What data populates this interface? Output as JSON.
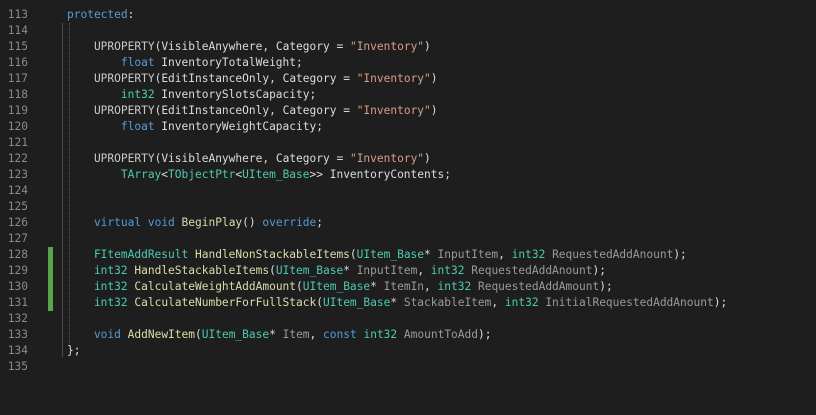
{
  "editor": {
    "lines": [
      {
        "num": "113",
        "tokens": [
          {
            "t": "protected",
            "c": "kw"
          },
          {
            "t": ":",
            "c": "pl"
          }
        ]
      },
      {
        "num": "114",
        "tokens": []
      },
      {
        "num": "115",
        "tokens": [
          {
            "t": "    UPROPERTY",
            "c": "mac"
          },
          {
            "t": "(",
            "c": "pl"
          },
          {
            "t": "VisibleAnywhere",
            "c": "pl"
          },
          {
            "t": ", ",
            "c": "pl"
          },
          {
            "t": "Category",
            "c": "pl"
          },
          {
            "t": " = ",
            "c": "pl"
          },
          {
            "t": "\"Inventory\"",
            "c": "str"
          },
          {
            "t": ")",
            "c": "pl"
          }
        ]
      },
      {
        "num": "116",
        "tokens": [
          {
            "t": "        float",
            "c": "kw"
          },
          {
            "t": " InventoryTotalWeight;",
            "c": "pl"
          }
        ]
      },
      {
        "num": "117",
        "tokens": [
          {
            "t": "    UPROPERTY",
            "c": "mac"
          },
          {
            "t": "(",
            "c": "pl"
          },
          {
            "t": "EditInstanceOnly",
            "c": "pl"
          },
          {
            "t": ", ",
            "c": "pl"
          },
          {
            "t": "Category",
            "c": "pl"
          },
          {
            "t": " = ",
            "c": "pl"
          },
          {
            "t": "\"Inventory\"",
            "c": "str"
          },
          {
            "t": ")",
            "c": "pl"
          }
        ]
      },
      {
        "num": "118",
        "tokens": [
          {
            "t": "        int32",
            "c": "ty"
          },
          {
            "t": " InventorySlotsCapacity;",
            "c": "pl"
          }
        ]
      },
      {
        "num": "119",
        "tokens": [
          {
            "t": "    UPROPERTY",
            "c": "mac"
          },
          {
            "t": "(",
            "c": "pl"
          },
          {
            "t": "EditInstanceOnly",
            "c": "pl"
          },
          {
            "t": ", ",
            "c": "pl"
          },
          {
            "t": "Category",
            "c": "pl"
          },
          {
            "t": " = ",
            "c": "pl"
          },
          {
            "t": "\"Inventory\"",
            "c": "str"
          },
          {
            "t": ")",
            "c": "pl"
          }
        ]
      },
      {
        "num": "120",
        "tokens": [
          {
            "t": "        float",
            "c": "kw"
          },
          {
            "t": " InventoryWeightCapacity;",
            "c": "pl"
          }
        ]
      },
      {
        "num": "121",
        "tokens": []
      },
      {
        "num": "122",
        "tokens": [
          {
            "t": "    UPROPERTY",
            "c": "mac"
          },
          {
            "t": "(",
            "c": "pl"
          },
          {
            "t": "VisibleAnywhere",
            "c": "pl"
          },
          {
            "t": ", ",
            "c": "pl"
          },
          {
            "t": "Category",
            "c": "pl"
          },
          {
            "t": " = ",
            "c": "pl"
          },
          {
            "t": "\"Inventory\"",
            "c": "str"
          },
          {
            "t": ")",
            "c": "pl"
          }
        ]
      },
      {
        "num": "123",
        "tokens": [
          {
            "t": "        TArray",
            "c": "ty"
          },
          {
            "t": "<",
            "c": "pl"
          },
          {
            "t": "TObjectPtr",
            "c": "ty"
          },
          {
            "t": "<",
            "c": "pl"
          },
          {
            "t": "UItem_Base",
            "c": "ty"
          },
          {
            "t": ">> InventoryContents;",
            "c": "pl"
          }
        ]
      },
      {
        "num": "124",
        "tokens": []
      },
      {
        "num": "125",
        "tokens": []
      },
      {
        "num": "126",
        "tokens": [
          {
            "t": "    virtual",
            "c": "kw"
          },
          {
            "t": " ",
            "c": "pl"
          },
          {
            "t": "void",
            "c": "kw"
          },
          {
            "t": " ",
            "c": "pl"
          },
          {
            "t": "BeginPlay",
            "c": "fn"
          },
          {
            "t": "() ",
            "c": "pl"
          },
          {
            "t": "override",
            "c": "kw"
          },
          {
            "t": ";",
            "c": "pl"
          }
        ]
      },
      {
        "num": "127",
        "tokens": []
      },
      {
        "num": "128",
        "tokens": [
          {
            "t": "    FItemAddResult",
            "c": "ty"
          },
          {
            "t": " ",
            "c": "pl"
          },
          {
            "t": "HandleNonStackableItems",
            "c": "fn"
          },
          {
            "t": "(",
            "c": "pl"
          },
          {
            "t": "UItem_Base",
            "c": "ty"
          },
          {
            "t": "* ",
            "c": "pl"
          },
          {
            "t": "InputItem",
            "c": "param"
          },
          {
            "t": ", ",
            "c": "pl"
          },
          {
            "t": "int32",
            "c": "ty"
          },
          {
            "t": " ",
            "c": "pl"
          },
          {
            "t": "RequestedAddAnount",
            "c": "param"
          },
          {
            "t": ");",
            "c": "pl"
          }
        ]
      },
      {
        "num": "129",
        "tokens": [
          {
            "t": "    int32",
            "c": "ty"
          },
          {
            "t": " ",
            "c": "pl"
          },
          {
            "t": "HandleStackableItems",
            "c": "fn"
          },
          {
            "t": "(",
            "c": "pl"
          },
          {
            "t": "UItem_Base",
            "c": "ty"
          },
          {
            "t": "* ",
            "c": "pl"
          },
          {
            "t": "InputItem",
            "c": "param"
          },
          {
            "t": ", ",
            "c": "pl"
          },
          {
            "t": "int32",
            "c": "ty"
          },
          {
            "t": " ",
            "c": "pl"
          },
          {
            "t": "RequestedAddAnount",
            "c": "param"
          },
          {
            "t": ");",
            "c": "pl"
          }
        ]
      },
      {
        "num": "130",
        "tokens": [
          {
            "t": "    int32",
            "c": "ty"
          },
          {
            "t": " ",
            "c": "pl"
          },
          {
            "t": "CalculateWeightAddAmount",
            "c": "fn"
          },
          {
            "t": "(",
            "c": "pl"
          },
          {
            "t": "UItem_Base",
            "c": "ty"
          },
          {
            "t": "* ",
            "c": "pl"
          },
          {
            "t": "ItemIn",
            "c": "param"
          },
          {
            "t": ", ",
            "c": "pl"
          },
          {
            "t": "int32",
            "c": "ty"
          },
          {
            "t": " ",
            "c": "pl"
          },
          {
            "t": "RequestedAddAmount",
            "c": "param"
          },
          {
            "t": ");",
            "c": "pl"
          }
        ]
      },
      {
        "num": "131",
        "tokens": [
          {
            "t": "    int32",
            "c": "ty"
          },
          {
            "t": " ",
            "c": "pl"
          },
          {
            "t": "CalculateNumberForFullStack",
            "c": "fn"
          },
          {
            "t": "(",
            "c": "pl"
          },
          {
            "t": "UItem_Base",
            "c": "ty"
          },
          {
            "t": "* ",
            "c": "pl"
          },
          {
            "t": "StackableItem",
            "c": "param"
          },
          {
            "t": ", ",
            "c": "pl"
          },
          {
            "t": "int32",
            "c": "ty"
          },
          {
            "t": " ",
            "c": "pl"
          },
          {
            "t": "InitialRequestedAddAnount",
            "c": "param"
          },
          {
            "t": ");",
            "c": "pl"
          }
        ]
      },
      {
        "num": "132",
        "tokens": []
      },
      {
        "num": "133",
        "tokens": [
          {
            "t": "    void",
            "c": "kw"
          },
          {
            "t": " ",
            "c": "pl"
          },
          {
            "t": "AddNewItem",
            "c": "fn"
          },
          {
            "t": "(",
            "c": "pl"
          },
          {
            "t": "UItem_Base",
            "c": "ty"
          },
          {
            "t": "* ",
            "c": "pl"
          },
          {
            "t": "Item",
            "c": "param"
          },
          {
            "t": ", ",
            "c": "pl"
          },
          {
            "t": "const",
            "c": "kw"
          },
          {
            "t": " ",
            "c": "pl"
          },
          {
            "t": "int32",
            "c": "ty"
          },
          {
            "t": " ",
            "c": "pl"
          },
          {
            "t": "AmountToAdd",
            "c": "param"
          },
          {
            "t": ");",
            "c": "pl"
          }
        ]
      },
      {
        "num": "134",
        "tokens": [
          {
            "t": "};",
            "c": "pl"
          }
        ]
      },
      {
        "num": "135",
        "tokens": []
      }
    ],
    "modified_lines": [
      "128",
      "129",
      "130",
      "131"
    ]
  },
  "colors": {
    "background": "#1e1e1e",
    "line_number": "#8a8a8a",
    "keyword": "#569cd6",
    "type": "#4ec9b0",
    "string": "#d69d85",
    "function": "#dcdcaa",
    "parameter": "#9a9a9a",
    "plain": "#dcdcdc",
    "change_marker": "#57a64a"
  }
}
